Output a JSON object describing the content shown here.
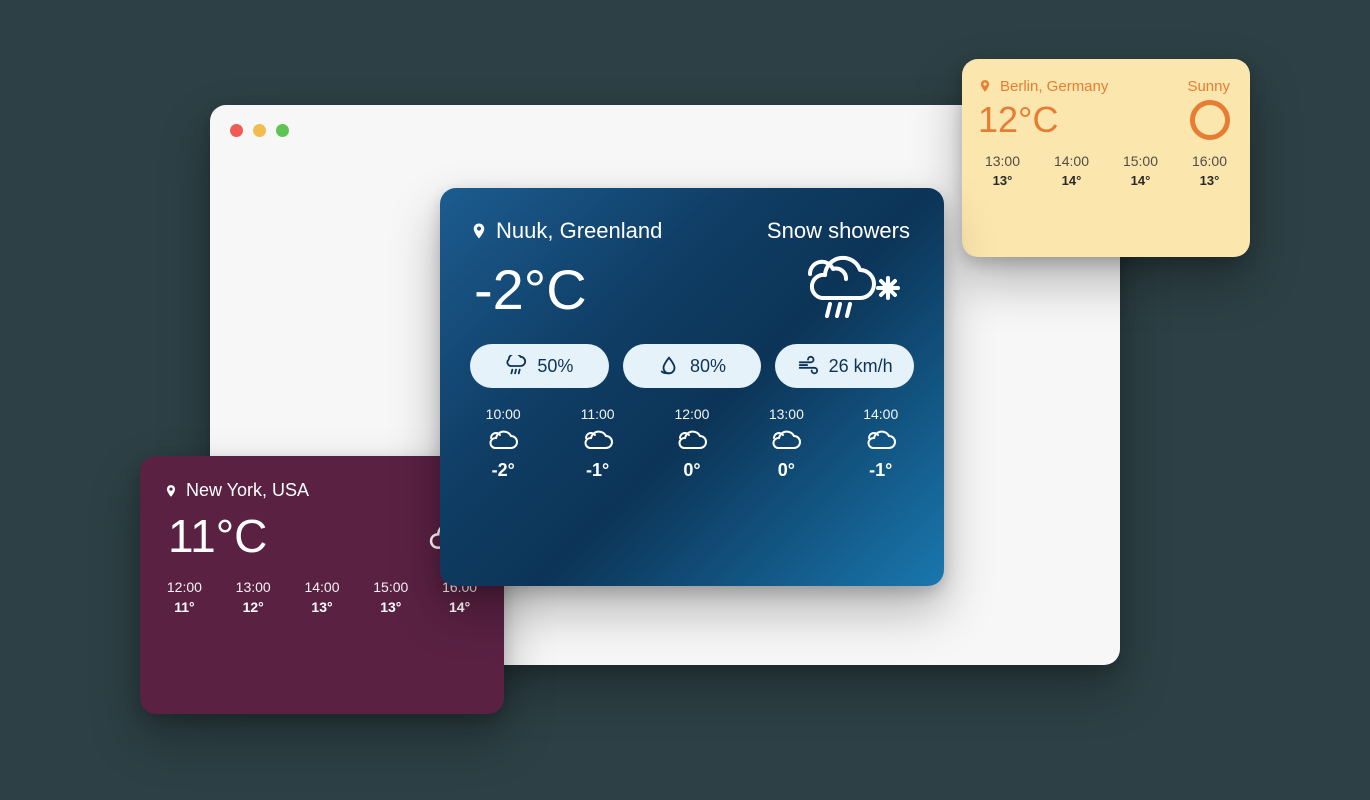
{
  "cards": {
    "nyc": {
      "location": "New York, USA",
      "condition": "Cloudy",
      "temp": "11°C",
      "hourly": [
        {
          "time": "12:00",
          "temp": "11°"
        },
        {
          "time": "13:00",
          "temp": "12°"
        },
        {
          "time": "14:00",
          "temp": "13°"
        },
        {
          "time": "15:00",
          "temp": "13°"
        },
        {
          "time": "16:00",
          "temp": "14°"
        }
      ]
    },
    "berlin": {
      "location": "Berlin, Germany",
      "condition": "Sunny",
      "temp": "12°C",
      "hourly": [
        {
          "time": "13:00",
          "temp": "13°"
        },
        {
          "time": "14:00",
          "temp": "14°"
        },
        {
          "time": "15:00",
          "temp": "14°"
        },
        {
          "time": "16:00",
          "temp": "13°"
        }
      ]
    },
    "nuuk": {
      "location": "Nuuk, Greenland",
      "condition": "Snow showers",
      "temp": "-2°C",
      "metrics": {
        "precip": "50%",
        "humidity": "80%",
        "wind": "26 km/h"
      },
      "hourly": [
        {
          "time": "10:00",
          "temp": "-2°"
        },
        {
          "time": "11:00",
          "temp": "-1°"
        },
        {
          "time": "12:00",
          "temp": "0°"
        },
        {
          "time": "13:00",
          "temp": "0°"
        },
        {
          "time": "14:00",
          "temp": "-1°"
        }
      ]
    }
  }
}
